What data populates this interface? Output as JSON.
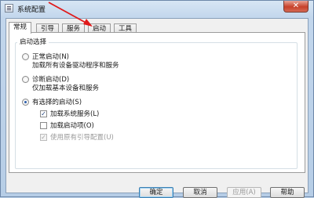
{
  "window": {
    "title": "系统配置",
    "close_symbol": "✕"
  },
  "tabs": [
    {
      "label": "常规",
      "active": true
    },
    {
      "label": "引导",
      "active": false
    },
    {
      "label": "服务",
      "active": false
    },
    {
      "label": "启动",
      "active": false
    },
    {
      "label": "工具",
      "active": false
    }
  ],
  "general": {
    "group_title": "启动选择",
    "normal": {
      "label": "正常启动(N)",
      "desc": "加载所有设备驱动程序和服务",
      "selected": false
    },
    "diagnostic": {
      "label": "诊断启动(D)",
      "desc": "仅加载基本设备和服务",
      "selected": false
    },
    "selective": {
      "label": "有选择的启动(S)",
      "selected": true,
      "options": [
        {
          "label": "加载系统服务(L)",
          "checked": true,
          "enabled": true
        },
        {
          "label": "加载启动项(O)",
          "checked": false,
          "enabled": true
        },
        {
          "label": "使用原有引导配置(U)",
          "checked": true,
          "enabled": false
        }
      ]
    }
  },
  "buttons": {
    "ok": "确定",
    "cancel": "取消",
    "apply": "应用(A)",
    "help": "帮助"
  },
  "icons": {
    "arrow_color": "#e0191a"
  }
}
